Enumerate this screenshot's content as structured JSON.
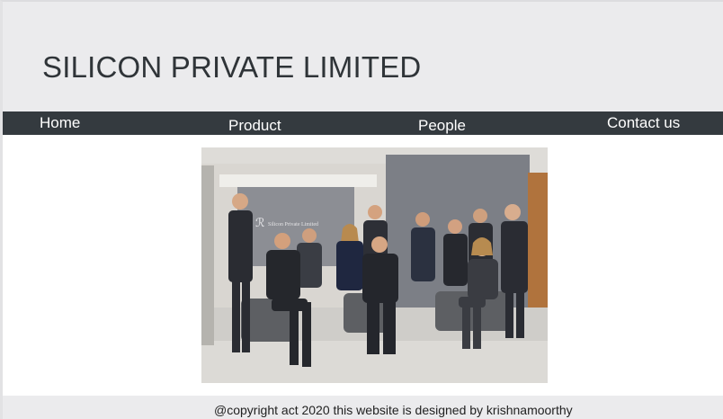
{
  "header": {
    "title": "SILICON PRIVATE LIMITED"
  },
  "nav": {
    "items": [
      {
        "label": "Home"
      },
      {
        "label": "Product"
      },
      {
        "label": "People"
      },
      {
        "label": "Contact us"
      }
    ]
  },
  "main": {
    "photo": {
      "sign_text": "Silicon Private Limited"
    }
  },
  "footer": {
    "text": "@copyright act 2020 this website is designed by krishnamoorthy"
  },
  "colors": {
    "header_bg": "#ebebed",
    "nav_bg": "#343a3f",
    "nav_text": "#ffffff",
    "title_text": "#2f3438",
    "footer_bg": "#ebebed"
  }
}
